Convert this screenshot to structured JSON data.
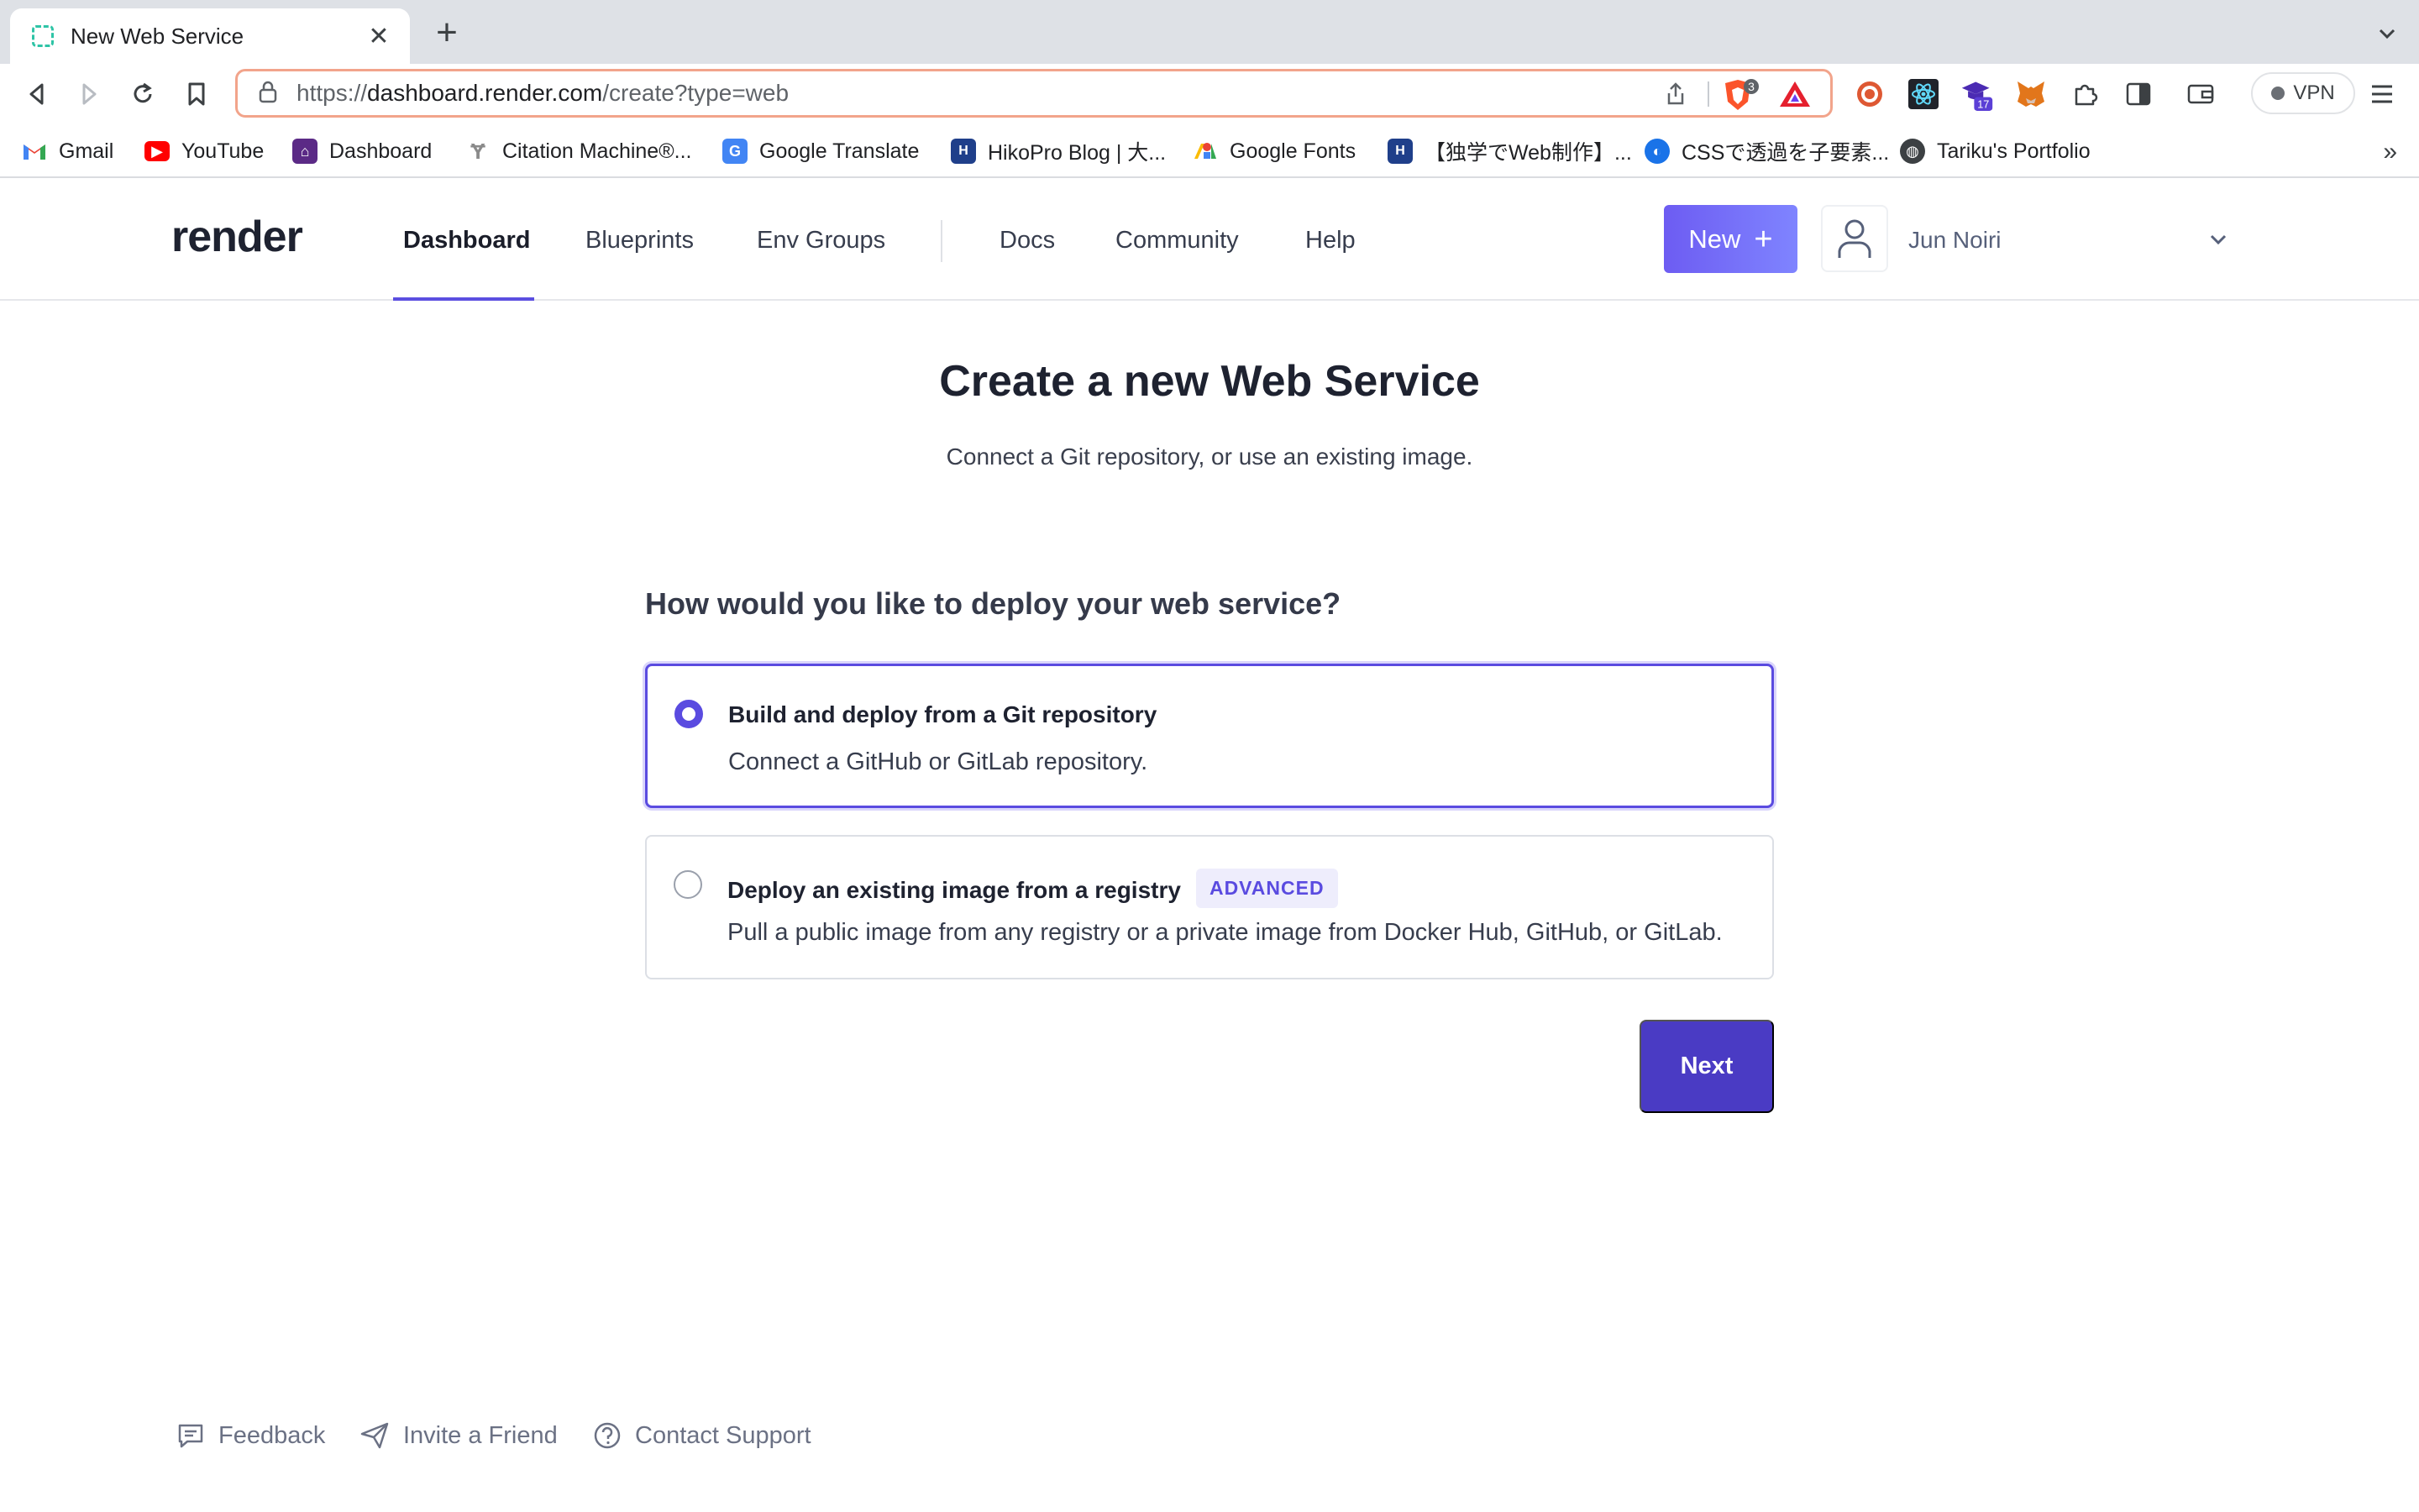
{
  "browser": {
    "tab_title": "New Web Service",
    "tab_close": "✕",
    "new_tab": "+",
    "url_scheme": "https://",
    "url_host": "dashboard.render.com",
    "url_path": "/create?type=web",
    "shield_count": "3",
    "ext_badge_count": "17",
    "vpn_label": "VPN",
    "bookmarks": [
      {
        "label": "Gmail",
        "icon": "gmail-icon",
        "color": "#ea4335"
      },
      {
        "label": "YouTube",
        "icon": "youtube-icon",
        "color": "#ff0000"
      },
      {
        "label": "Dashboard",
        "icon": "dashboard-icon",
        "color": "#5b2a86"
      },
      {
        "label": "Citation Machine®...",
        "icon": "citation-machine-icon",
        "color": "#8a8a8a"
      },
      {
        "label": "Google Translate",
        "icon": "google-translate-icon",
        "color": "#4285f4"
      },
      {
        "label": "HikoPro Blog | 大...",
        "icon": "hikopro-icon",
        "color": "#1f3f8a"
      },
      {
        "label": "Google Fonts",
        "icon": "google-fonts-icon",
        "color": "#34a853"
      },
      {
        "label": "【独学でWeb制作】...",
        "icon": "hikopro-icon-2",
        "color": "#1f3f8a"
      },
      {
        "label": "CSSで透過を子要素...",
        "icon": "css-site-icon",
        "color": "#1a73e8"
      },
      {
        "label": "Tariku's Portfolio",
        "icon": "globe-icon",
        "color": "#3c4043"
      }
    ],
    "bookmarks_more": "»"
  },
  "header": {
    "logo": "render",
    "nav": [
      {
        "label": "Dashboard",
        "active": true
      },
      {
        "label": "Blueprints",
        "active": false
      },
      {
        "label": "Env Groups",
        "active": false
      },
      {
        "label": "Docs",
        "active": false
      },
      {
        "label": "Community",
        "active": false
      },
      {
        "label": "Help",
        "active": false
      }
    ],
    "new_button": "New",
    "new_button_plus": "+",
    "user_name": "Jun Noiri"
  },
  "main": {
    "title_prefix": "Create a new",
    "title_bold": "Web Service",
    "subtitle": "Connect a Git repository, or use an existing image.",
    "question": "How would you like to deploy your web service?",
    "options": [
      {
        "title": "Build and deploy from a Git repository",
        "description": "Connect a GitHub or GitLab repository.",
        "selected": true
      },
      {
        "title": "Deploy an existing image from a registry",
        "badge": "ADVANCED",
        "description": "Pull a public image from any registry or a private image from Docker Hub, GitHub, or GitLab.",
        "selected": false
      }
    ],
    "next_button": "Next"
  },
  "footer": {
    "links": [
      "Feedback",
      "Invite a Friend",
      "Contact Support"
    ]
  },
  "colors": {
    "accent": "#5a4be0",
    "next_button": "#4a3bc4",
    "new_button_gradient_start": "#6d5cf2",
    "new_button_gradient_end": "#7f84ff",
    "badge_bg": "#eeedfc"
  }
}
